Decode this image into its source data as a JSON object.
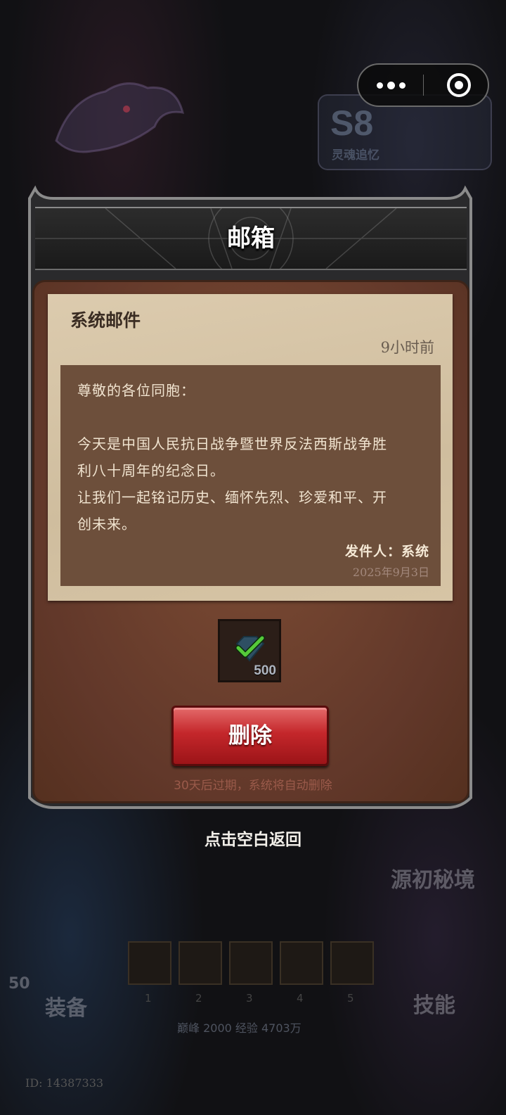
{
  "background": {
    "season_badge": "S8",
    "season_label": "灵魂追忆",
    "secret_realm_label": "源初秘境",
    "equipment_label": "装备",
    "skills_label": "技能",
    "level_badge": "50",
    "peak_exp": "巅峰 2000   经验 4703万",
    "slot_numbers": [
      "1",
      "2",
      "3",
      "4",
      "5"
    ],
    "user_id": "ID: 14387333"
  },
  "capsule": {
    "more_icon": "more-dots-icon",
    "close_icon": "target-close-icon"
  },
  "modal": {
    "title": "邮箱",
    "mail": {
      "type": "系统邮件",
      "time": "9小时前",
      "greeting": "尊敬的各位同胞：",
      "body_lines": [
        "今天是中国人民抗日战争暨世界反法西斯战争胜",
        "利八十周年的纪念日。",
        "让我们一起铭记历史、缅怀先烈、珍爱和平、开",
        "创未来。"
      ],
      "sender": "发件人：系统",
      "date": "2025年9月3日"
    },
    "reward": {
      "icon": "gem-claimed-icon",
      "count": "500",
      "claimed": true
    },
    "delete_label": "删除",
    "expire_note": "30天后过期，系统将自动删除"
  },
  "back_hint": "点击空白返回",
  "colors": {
    "paper": "#d6c4a5",
    "letter": "#6d4f3b",
    "delete": "#c4272b",
    "panel": "#6e4230"
  }
}
